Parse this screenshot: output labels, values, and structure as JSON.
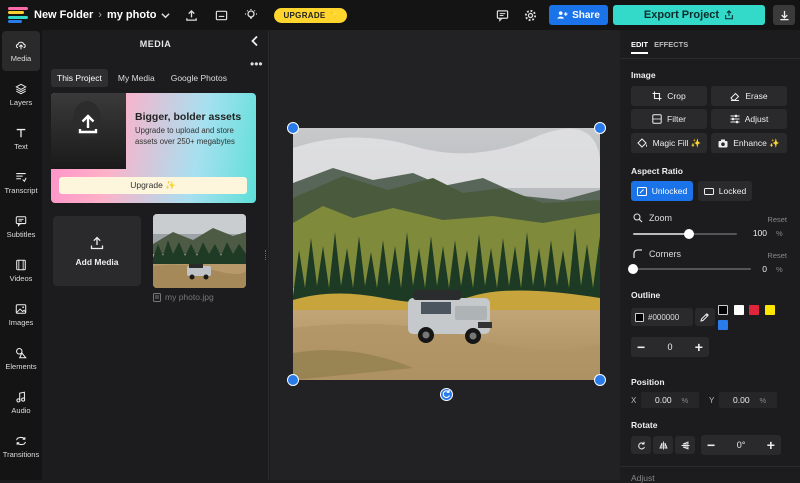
{
  "topbar": {
    "folder": "New Folder",
    "file": "my photo",
    "upgrade": "UPGRADE ✨",
    "share": "Share",
    "export": "Export Project"
  },
  "nav": [
    {
      "label": "Media",
      "icon": "upload-cloud-icon"
    },
    {
      "label": "Layers",
      "icon": "layers-icon"
    },
    {
      "label": "Text",
      "icon": "text-icon"
    },
    {
      "label": "Transcript",
      "icon": "transcript-icon"
    },
    {
      "label": "Subtitles",
      "icon": "subtitles-icon"
    },
    {
      "label": "Videos",
      "icon": "film-icon"
    },
    {
      "label": "Images",
      "icon": "image-icon"
    },
    {
      "label": "Elements",
      "icon": "shapes-icon"
    },
    {
      "label": "Audio",
      "icon": "music-note-icon"
    },
    {
      "label": "Transitions",
      "icon": "transitions-icon"
    }
  ],
  "media": {
    "title": "MEDIA",
    "tabs": [
      "This Project",
      "My Media",
      "Google Photos"
    ],
    "promo_title": "Bigger, bolder assets",
    "promo_body": "Upgrade to upload and store assets over 250+ megabytes",
    "promo_button": "Upgrade ✨",
    "add_media": "Add Media",
    "thumb_caption": "my photo.jpg"
  },
  "edit": {
    "tabs": [
      "EDIT",
      "EFFECTS"
    ],
    "image_section": "Image",
    "crop": "Crop",
    "erase": "Erase",
    "filter": "Filter",
    "adjust": "Adjust",
    "magic_fill": "Magic Fill ✨",
    "enhance": "Enhance ✨",
    "aspect_section": "Aspect Ratio",
    "unlocked": "Unlocked",
    "locked": "Locked",
    "zoom_label": "Zoom",
    "zoom_reset": "Reset",
    "zoom_value": "100",
    "zoom_fraction": 0.54,
    "pct": "%",
    "corners_label": "Corners",
    "corners_reset": "Reset",
    "corners_value": "0",
    "corners_fraction": 0,
    "outline_section": "Outline",
    "outline_hex": "#000000",
    "outline_width": "0",
    "swatches": [
      "#000000",
      "#ffffff",
      "#e0243a",
      "#ffe600",
      "#2a7bea"
    ],
    "position_section": "Position",
    "x_label": "X",
    "x_value": "0.00",
    "y_label": "Y",
    "y_value": "0.00",
    "rotate_section": "Rotate",
    "rotate_value": "0°",
    "adjust_section": "Adjust"
  }
}
